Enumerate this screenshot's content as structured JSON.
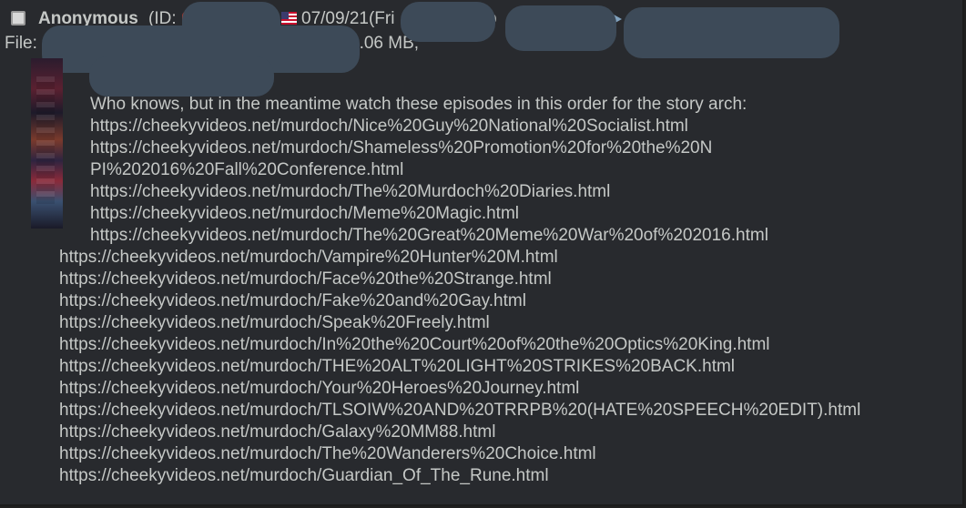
{
  "post": {
    "name": "Anonymous",
    "id_label": "(ID:",
    "date": "07/09/21(Fri",
    "date_suffix": "o",
    "file_label": "File:",
    "file_info": "1.06 MB, ",
    "message": {
      "intro": "Who knows, but in the meantime watch these episodes in this order for the story arch:",
      "indented_links": [
        "https://cheekyvideos.net/murdoch/Nice%20Guy%20National%20Socialist.html",
        "https://cheekyvideos.net/murdoch/Shameless%20Promotion%20for%20the%20N",
        "PI%202016%20Fall%20Conference.html",
        "https://cheekyvideos.net/murdoch/The%20Murdoch%20Diaries.html",
        "https://cheekyvideos.net/murdoch/Meme%20Magic.html",
        "https://cheekyvideos.net/murdoch/The%20Great%20Meme%20War%20of%202016.html"
      ],
      "links": [
        "https://cheekyvideos.net/murdoch/Vampire%20Hunter%20M.html",
        "https://cheekyvideos.net/murdoch/Face%20the%20Strange.html",
        "https://cheekyvideos.net/murdoch/Fake%20and%20Gay.html",
        "https://cheekyvideos.net/murdoch/Speak%20Freely.html",
        "https://cheekyvideos.net/murdoch/In%20the%20Court%20of%20the%20Optics%20King.html",
        "https://cheekyvideos.net/murdoch/THE%20ALT%20LIGHT%20STRIKES%20BACK.html",
        "https://cheekyvideos.net/murdoch/Your%20Heroes%20Journey.html",
        "https://cheekyvideos.net/murdoch/TLSOIW%20AND%20TRRPB%20(HATE%20SPEECH%20EDIT).html",
        "https://cheekyvideos.net/murdoch/Galaxy%20MM88.html",
        "https://cheekyvideos.net/murdoch/The%20Wanderers%20Choice.html",
        "https://cheekyvideos.net/murdoch/Guardian_Of_The_Rune.html"
      ]
    }
  },
  "icons": {
    "checkbox": "select-post-checkbox",
    "flag": "us-flag-icon",
    "arrow": "reply-arrow-icon"
  },
  "colors": {
    "background": "#282a2e",
    "text": "#c5c8c6",
    "redaction": "#3d4a58"
  }
}
